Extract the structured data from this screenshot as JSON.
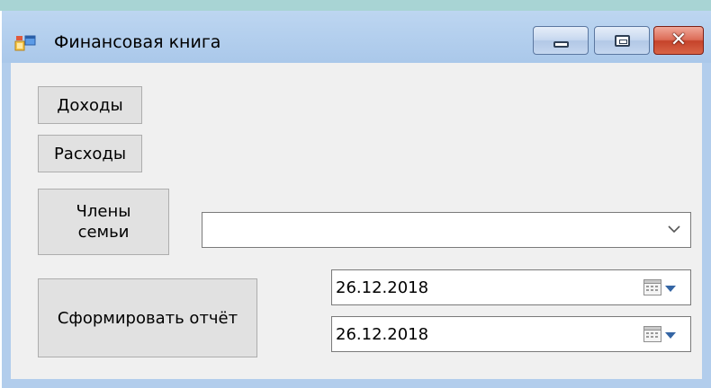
{
  "window": {
    "title": "Финансовая книга",
    "controls": {
      "minimize": "minimize",
      "maximize": "maximize",
      "close": "✕"
    }
  },
  "buttons": {
    "income": "Доходы",
    "expenses": "Расходы",
    "family_line1": "Члены",
    "family_line2": "семьи",
    "report": "Сформировать отчёт"
  },
  "family_combo": {
    "value": ""
  },
  "dates": {
    "from": "26.12.2018",
    "to": "26.12.2018"
  },
  "icons": {
    "app": "form-window-icon",
    "combo": "chevron-down-icon",
    "date": "calendar-icon"
  },
  "colors": {
    "titlebar": "#aac8ea",
    "close": "#c5432b",
    "client": "#f0f0f0",
    "button": "#e1e1e1",
    "dropdown_arrow": "#3465a4"
  }
}
